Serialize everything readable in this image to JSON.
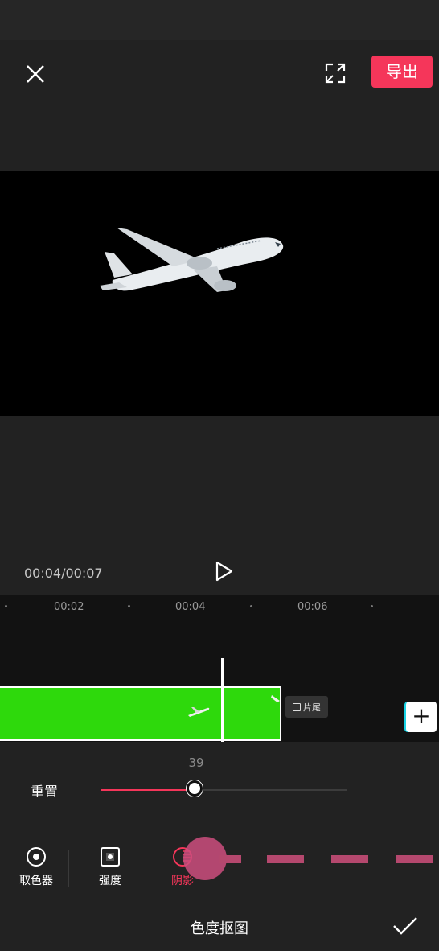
{
  "header": {
    "export_label": "导出"
  },
  "player": {
    "time": "00:04/00:07"
  },
  "timeline": {
    "ticks": [
      "00:02",
      "00:04",
      "00:06"
    ],
    "outro_label": "片尾",
    "add_label": "+"
  },
  "adjust": {
    "value": "39",
    "reset_label": "重置",
    "slider_fraction": 0.39
  },
  "tools": [
    {
      "label": "取色器",
      "icon": "color-picker-icon",
      "active": false
    },
    {
      "label": "强度",
      "icon": "intensity-icon",
      "active": false
    },
    {
      "label": "阴影",
      "icon": "shadow-icon",
      "active": true
    }
  ],
  "bottom": {
    "title": "色度抠图"
  },
  "colors": {
    "accent": "#f5365a",
    "clip_green": "#2ed90c",
    "touch": "#cc4e7e"
  }
}
